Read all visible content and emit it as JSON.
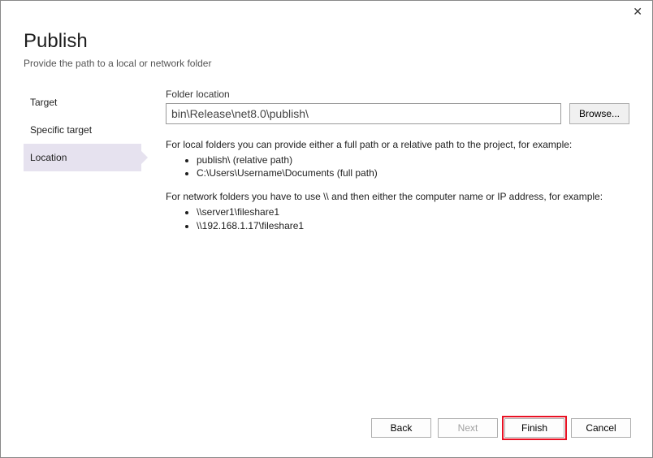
{
  "close_glyph": "✕",
  "header": {
    "title": "Publish",
    "subtitle": "Provide the path to a local or network folder"
  },
  "sidebar": {
    "items": [
      {
        "label": "Target",
        "active": false
      },
      {
        "label": "Specific target",
        "active": false
      },
      {
        "label": "Location",
        "active": true
      }
    ]
  },
  "content": {
    "field_label": "Folder location",
    "folder_value": "bin\\Release\\net8.0\\publish\\",
    "browse_label": "Browse...",
    "help_local_intro": "For local folders you can provide either a full path or a relative path to the project, for example:",
    "help_local_ex1": "publish\\ (relative path)",
    "help_local_ex2": "C:\\Users\\Username\\Documents (full path)",
    "help_net_intro": "For network folders you have to use \\\\ and then either the computer name or IP address, for example:",
    "help_net_ex1": "\\\\server1\\fileshare1",
    "help_net_ex2": "\\\\192.168.1.17\\fileshare1"
  },
  "buttons": {
    "back": "Back",
    "next": "Next",
    "finish": "Finish",
    "cancel": "Cancel"
  }
}
